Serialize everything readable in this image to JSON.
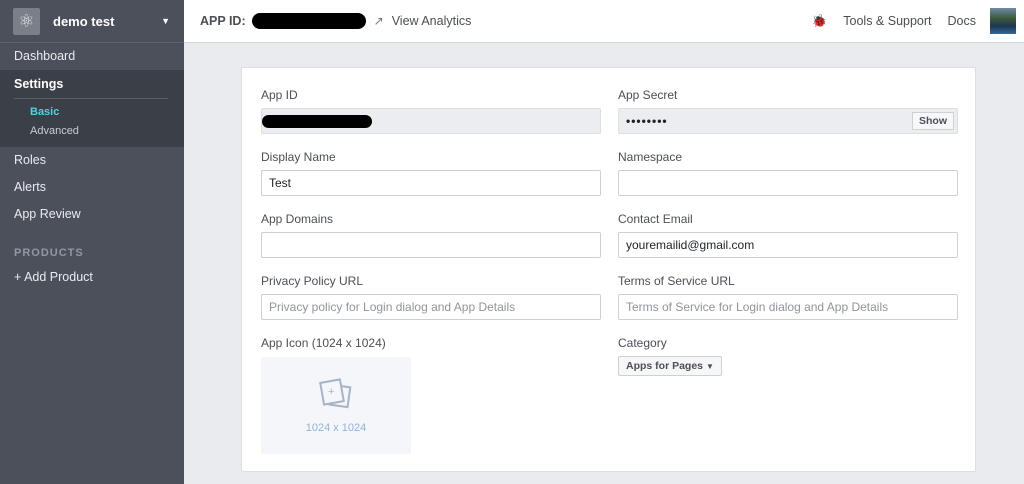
{
  "sidebar": {
    "app_name": "demo test",
    "dashboard": "Dashboard",
    "settings": "Settings",
    "sub": [
      "Basic",
      "Advanced"
    ],
    "roles": "Roles",
    "alerts": "Alerts",
    "app_review": "App Review",
    "products_heading": "PRODUCTS",
    "add_product": "+ Add Product"
  },
  "topbar": {
    "app_id_label": "APP ID:",
    "view_analytics": "View Analytics",
    "tools_support": "Tools & Support",
    "docs": "Docs"
  },
  "form": {
    "app_id_label": "App ID",
    "app_secret_label": "App Secret",
    "app_secret_value": "••••••••",
    "show": "Show",
    "display_name_label": "Display Name",
    "display_name_value": "Test",
    "namespace_label": "Namespace",
    "namespace_value": "",
    "app_domains_label": "App Domains",
    "app_domains_value": "",
    "contact_email_label": "Contact Email",
    "contact_email_value": "youremailid@gmail.com",
    "privacy_label": "Privacy Policy URL",
    "privacy_placeholder": "Privacy policy for Login dialog and App Details",
    "tos_label": "Terms of Service URL",
    "tos_placeholder": "Terms of Service for Login dialog and App Details",
    "app_icon_label": "App Icon (1024 x 1024)",
    "app_icon_size": "1024 x 1024",
    "category_label": "Category",
    "category_value": "Apps for Pages"
  }
}
